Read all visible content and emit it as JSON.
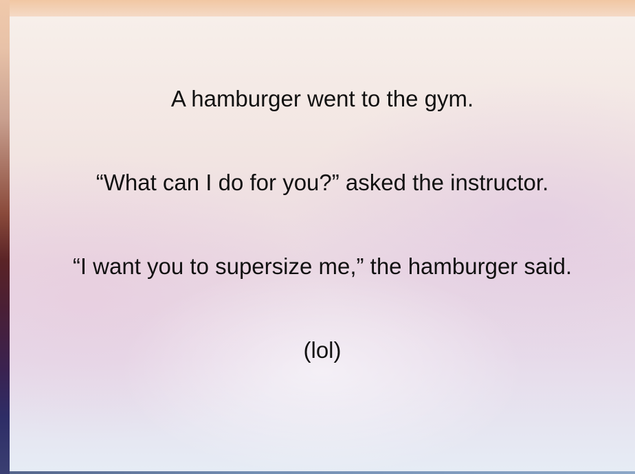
{
  "slide": {
    "lines": [
      "A hamburger went to the gym.",
      "“What can I do for you?” asked the instructor.",
      "“I want you to supersize me,” the hamburger said.",
      "(lol)"
    ]
  }
}
